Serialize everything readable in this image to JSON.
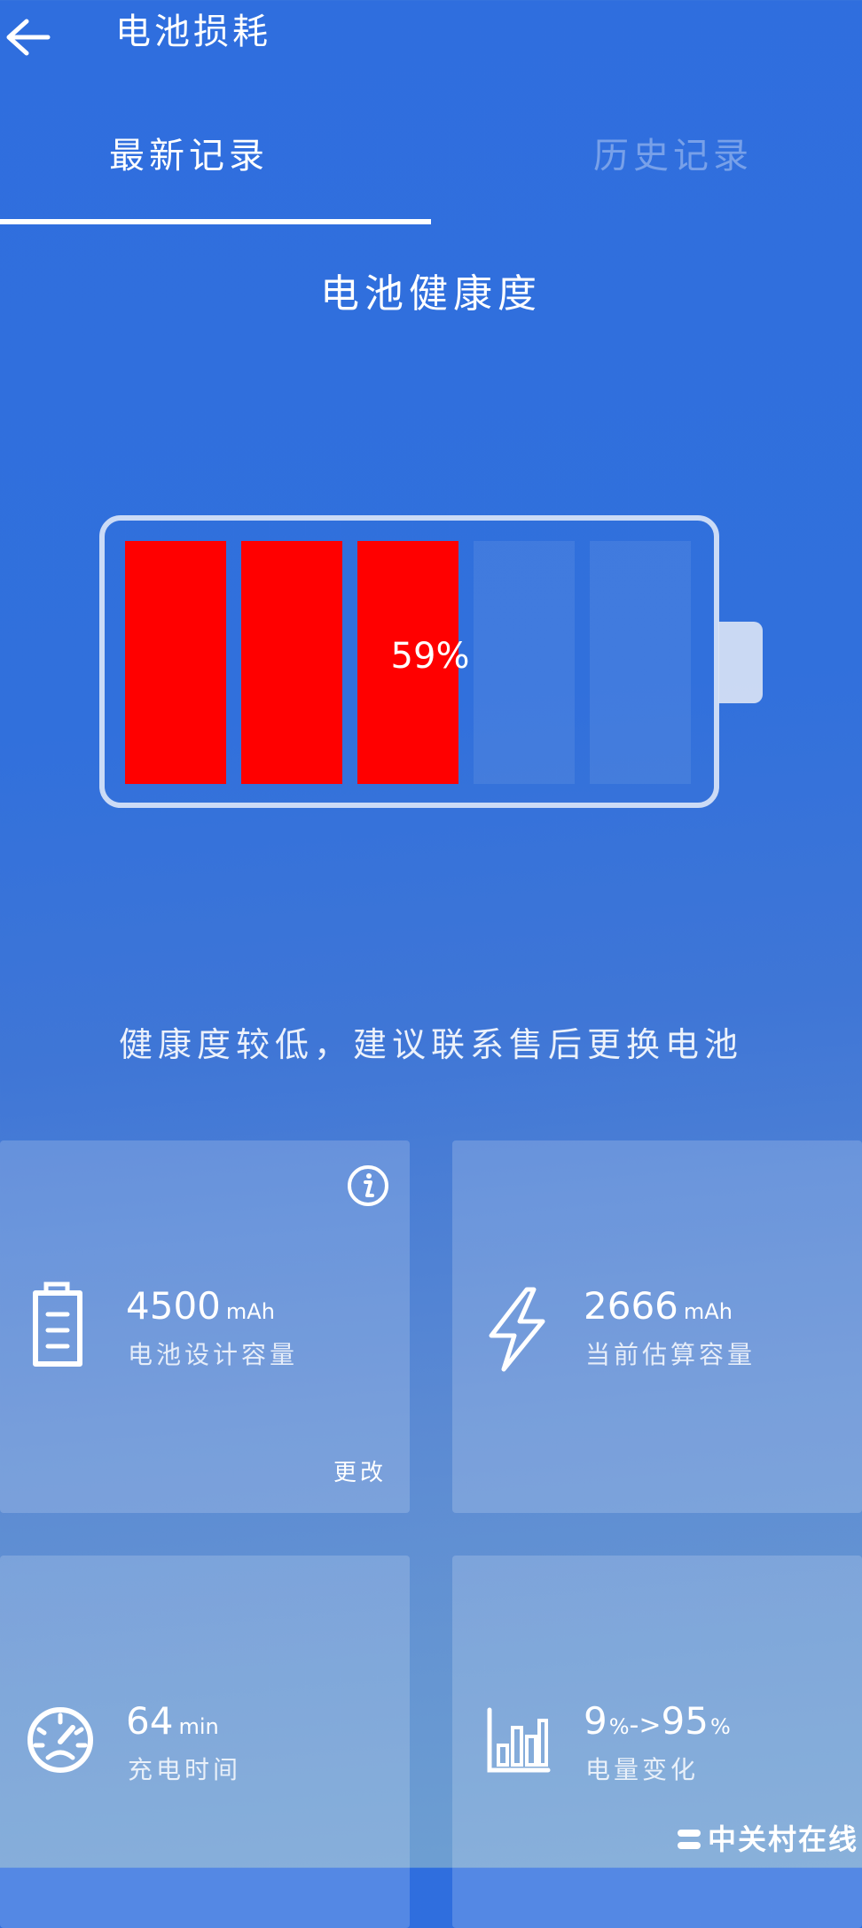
{
  "header": {
    "title": "电池损耗"
  },
  "tabs": {
    "latest": "最新记录",
    "history": "历史记录"
  },
  "health": {
    "title": "电池健康度",
    "percent_text": "59%",
    "percent": 59,
    "filled_cells": 3,
    "total_cells": 5,
    "advice": "健康度较低，建议联系售后更换电池"
  },
  "cards": {
    "design": {
      "value": "4500",
      "unit": "mAh",
      "label": "电池设计容量",
      "action": "更改"
    },
    "current": {
      "value": "2666",
      "unit": "mAh",
      "label": "当前估算容量"
    },
    "charge_time": {
      "value": "64",
      "unit": "min",
      "label": "充电时间"
    },
    "charge_change": {
      "value_from": "9",
      "unit_from": "%",
      "arrow": "->",
      "value_to": "95",
      "unit_to": "%",
      "label": "电量变化"
    }
  },
  "watermark": {
    "text": "中关村在线"
  },
  "icons": {
    "back": "arrow-left-icon",
    "info": "info-icon",
    "battery_card": "battery-icon",
    "current_card": "lightning-icon",
    "time_card": "speedometer-icon",
    "change_card": "bar-chart-icon"
  },
  "colors": {
    "filled_cell": "#ff0000",
    "empty_cell": "rgba(255,255,255,0.08)",
    "background": "#3170dc"
  }
}
